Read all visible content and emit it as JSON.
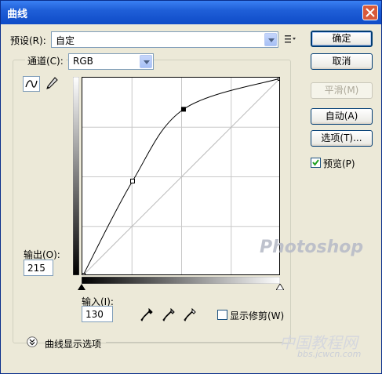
{
  "window": {
    "title": "曲线"
  },
  "preset": {
    "label": "预设(R):",
    "value": "自定"
  },
  "channel": {
    "label": "通道(C):",
    "value": "RGB"
  },
  "buttons": {
    "ok": "确定",
    "cancel": "取消",
    "smooth": "平滑(M)",
    "auto": "自动(A)",
    "options": "选项(T)..."
  },
  "preview": {
    "label": "预览(P)",
    "checked": true
  },
  "output": {
    "label": "输出(O):",
    "value": "215"
  },
  "input": {
    "label": "输入(I):",
    "value": "130"
  },
  "show_clipping": {
    "label": "显示修剪(W)",
    "checked": false
  },
  "curve_options": {
    "label": "曲线显示选项"
  },
  "curve": {
    "points": [
      [
        0,
        0
      ],
      [
        64,
        122
      ],
      [
        130,
        215
      ],
      [
        255,
        255
      ]
    ],
    "selected_point": [
      130,
      215
    ]
  },
  "watermark": {
    "logo_text": "Photoshop",
    "site_text": "中国教程网",
    "url_text": "bbs.jcwcn.com"
  },
  "icons": {
    "preset_menu": "preset-menu-icon",
    "curve_tool": "curve-tool-icon",
    "pencil_tool": "pencil-tool-icon",
    "eyedropper_black": "eyedropper-black-icon",
    "eyedropper_gray": "eyedropper-gray-icon",
    "eyedropper_white": "eyedropper-white-icon",
    "expand": "expand-chevron-icon"
  },
  "colors": {
    "titlebar": "#0e4bc7",
    "dialog_bg": "#ece9d8",
    "curve": "#000000"
  }
}
